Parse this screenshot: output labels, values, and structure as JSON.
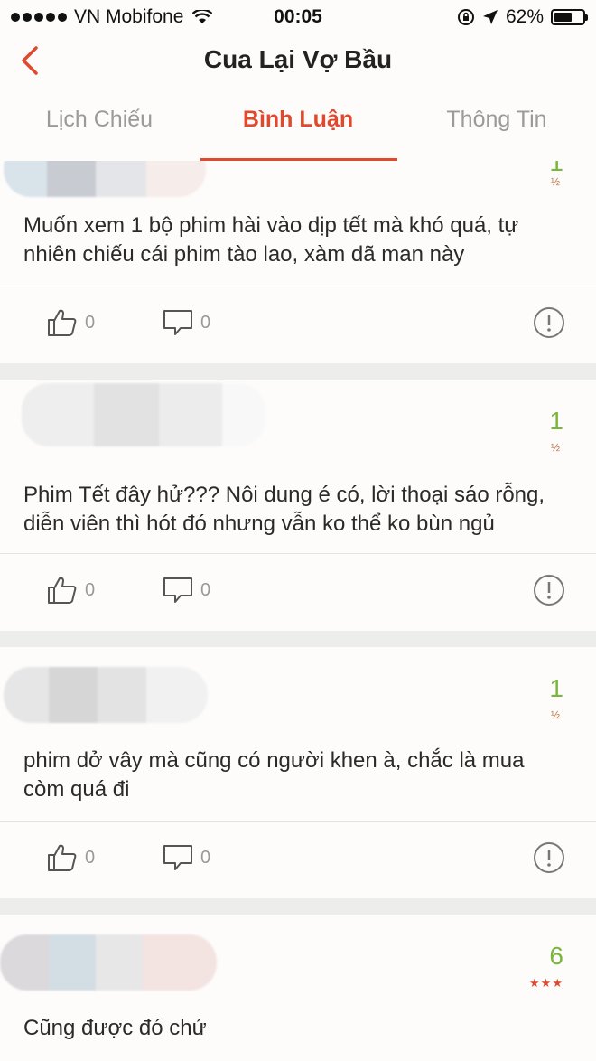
{
  "status": {
    "carrier": "VN Mobifone",
    "time": "00:05",
    "battery": "62%",
    "battery_level": 0.62
  },
  "nav": {
    "title": "Cua Lại Vợ Bầu"
  },
  "tabs": [
    {
      "label": "Lịch Chiếu",
      "active": false
    },
    {
      "label": "Bình Luận",
      "active": true
    },
    {
      "label": "Thông Tin",
      "active": false
    }
  ],
  "comments": [
    {
      "score": "1",
      "score_sub": "½",
      "text": "Muốn xem 1 bộ phim hài vào dịp tết mà khó quá, tự nhiên chiếu cái phim tào lao, xàm dã man này",
      "likes": "0",
      "replies": "0"
    },
    {
      "score": "1",
      "score_sub": "½",
      "text": "Phim Tết đây hử??? Nôi dung é  có, lời thoại sáo rỗng, diễn viên thì hót đó nhưng vẫn ko thể ko bùn ngủ",
      "likes": "0",
      "replies": "0"
    },
    {
      "score": "1",
      "score_sub": "½",
      "text": "  phim dở vây mà cũng có người khen à, chắc là mua còm quá đi",
      "likes": "0",
      "replies": "0"
    },
    {
      "score": "6",
      "stars": "★★★",
      "text": "Cũng được đó chứ"
    }
  ],
  "colors": {
    "accent": "#e0492e",
    "score": "#7ab63b",
    "muted": "#9a9a9a"
  }
}
